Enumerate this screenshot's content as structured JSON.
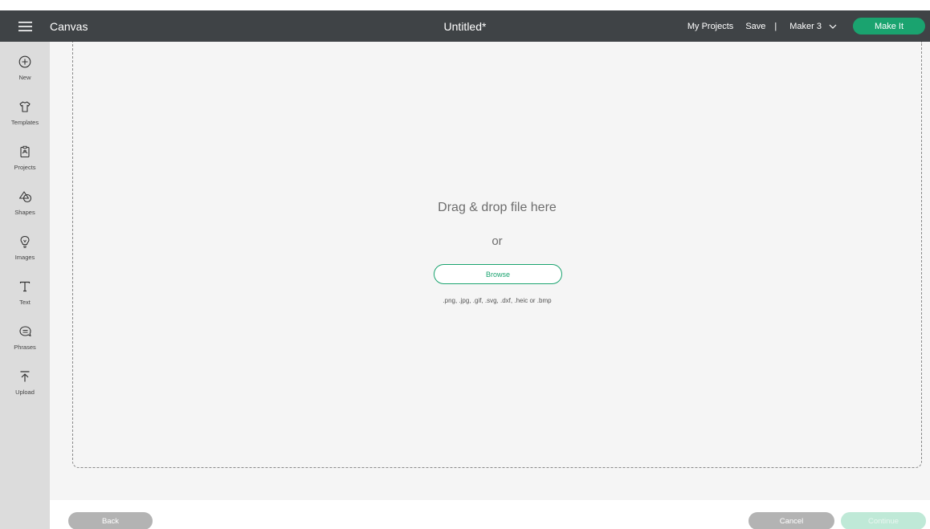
{
  "header": {
    "app_title": "Canvas",
    "doc_title": "Untitled*",
    "my_projects": "My Projects",
    "save": "Save",
    "separator": "|",
    "machine": "Maker 3",
    "make_it": "Make It"
  },
  "sidebar": {
    "items": [
      {
        "label": "New",
        "icon": "plus-circle-icon"
      },
      {
        "label": "Templates",
        "icon": "shirt-icon"
      },
      {
        "label": "Projects",
        "icon": "project-icon"
      },
      {
        "label": "Shapes",
        "icon": "shapes-icon"
      },
      {
        "label": "Images",
        "icon": "lightbulb-icon"
      },
      {
        "label": "Text",
        "icon": "text-icon"
      },
      {
        "label": "Phrases",
        "icon": "speech-bubble-icon"
      },
      {
        "label": "Upload",
        "icon": "upload-icon"
      }
    ]
  },
  "dropzone": {
    "title": "Drag & drop file here",
    "or": "or",
    "browse": "Browse",
    "formats": ".png, .jpg, .gif, .svg, .dxf, .heic or .bmp"
  },
  "footer": {
    "back": "Back",
    "cancel": "Cancel",
    "continue": "Continue"
  },
  "colors": {
    "topbar": "#3f4346",
    "accent": "#1aa36f",
    "sidebar": "#dcdcdc",
    "canvas": "#f5f5f5"
  }
}
